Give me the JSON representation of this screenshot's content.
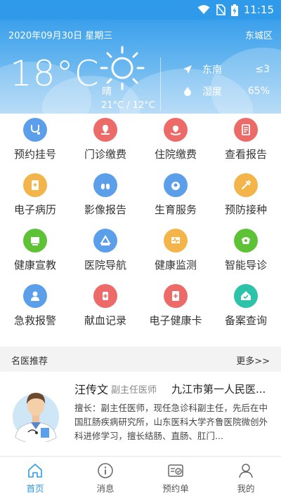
{
  "status_bar": {
    "time": "11:15"
  },
  "weather": {
    "date": "2020年09月30日 星期三",
    "district": "东城区",
    "temperature": "18°C",
    "condition": "晴",
    "range": "21°C / 12°C",
    "wind_direction": "东南",
    "wind_level": "≤3",
    "humidity_label": "湿度",
    "humidity_value": "65%"
  },
  "services": [
    {
      "label": "预约挂号",
      "icon": "stethoscope-icon",
      "color": "#5b9ee9"
    },
    {
      "label": "门诊缴费",
      "icon": "outpatient-pay-icon",
      "color": "#ec6a67"
    },
    {
      "label": "住院缴费",
      "icon": "inpatient-pay-icon",
      "color": "#ec6a67"
    },
    {
      "label": "查看报告",
      "icon": "report-icon",
      "color": "#ec6a67"
    },
    {
      "label": "电子病历",
      "icon": "medical-record-icon",
      "color": "#f3b44a"
    },
    {
      "label": "影像报告",
      "icon": "lungs-icon",
      "color": "#5b9ee9"
    },
    {
      "label": "生育服务",
      "icon": "baby-icon",
      "color": "#5b9ee9"
    },
    {
      "label": "预防接种",
      "icon": "syringe-icon",
      "color": "#f3b44a"
    },
    {
      "label": "健康宣教",
      "icon": "health-education-icon",
      "color": "#5ec236"
    },
    {
      "label": "医院导航",
      "icon": "hospital-navigation-icon",
      "color": "#5b9ee9"
    },
    {
      "label": "健康监测",
      "icon": "health-monitor-icon",
      "color": "#f3b44a"
    },
    {
      "label": "智能导诊",
      "icon": "smart-guide-icon",
      "color": "#5ec236"
    },
    {
      "label": "急救报警",
      "icon": "emergency-doctor-icon",
      "color": "#5b9ee9"
    },
    {
      "label": "献血记录",
      "icon": "blood-bag-icon",
      "color": "#ec6a67"
    },
    {
      "label": "电子健康卡",
      "icon": "health-card-icon",
      "color": "#ec6a67"
    },
    {
      "label": "备案查询",
      "icon": "home-record-icon",
      "color": "#2cc3a9"
    }
  ],
  "section": {
    "title": "名医推荐",
    "more": "更多>>"
  },
  "doctor": {
    "name": "汪传文",
    "title": "副主任医师",
    "hospital": "九江市第一人民医...",
    "description": "擅长：副主任医师，现任急诊科副主任，先后在中国肛肠疾病研究所，山东医科大学齐鲁医院微创外科进修学习，擅长结肠、直肠、肛门..."
  },
  "tabs": [
    {
      "label": "首页",
      "icon": "home-icon",
      "active": true
    },
    {
      "label": "消息",
      "icon": "info-icon",
      "active": false
    },
    {
      "label": "预约单",
      "icon": "appointment-icon",
      "active": false
    },
    {
      "label": "我的",
      "icon": "user-icon",
      "active": false
    }
  ],
  "colors": {
    "primary": "#2f9ae9",
    "header_light": "#a4d2f5"
  }
}
